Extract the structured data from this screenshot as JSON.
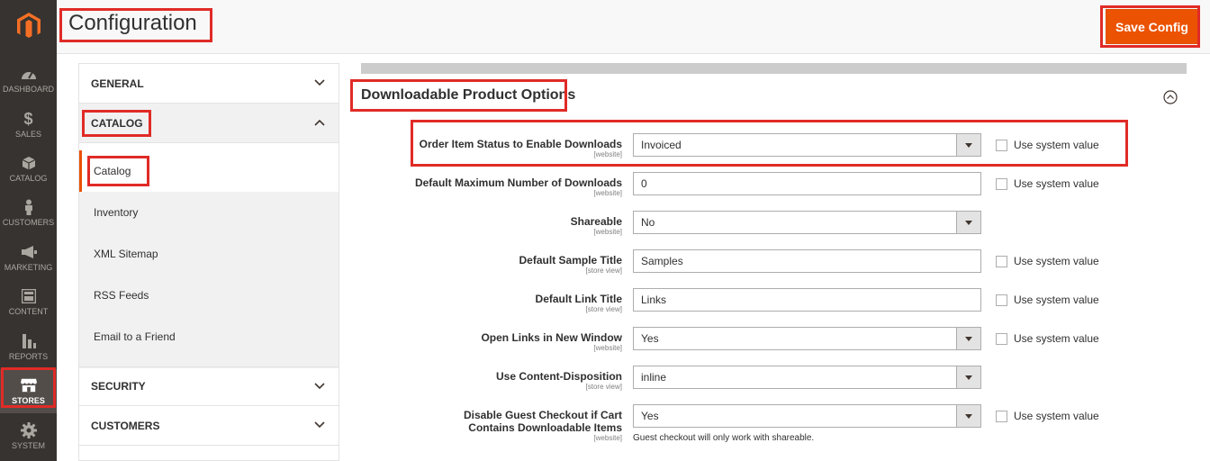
{
  "nav": {
    "items": [
      {
        "label": "DASHBOARD",
        "icon": "dashboard-icon"
      },
      {
        "label": "SALES",
        "icon": "dollar-icon"
      },
      {
        "label": "CATALOG",
        "icon": "box-icon"
      },
      {
        "label": "CUSTOMERS",
        "icon": "person-icon"
      },
      {
        "label": "MARKETING",
        "icon": "megaphone-icon"
      },
      {
        "label": "CONTENT",
        "icon": "layout-icon"
      },
      {
        "label": "REPORTS",
        "icon": "bar-chart-icon"
      },
      {
        "label": "STORES",
        "icon": "store-icon"
      },
      {
        "label": "SYSTEM",
        "icon": "gear-icon"
      }
    ]
  },
  "header": {
    "title": "Configuration",
    "save_label": "Save Config"
  },
  "tabs": {
    "general": "GENERAL",
    "catalog": "CATALOG",
    "security": "SECURITY",
    "customers": "CUSTOMERS",
    "catalog_items": [
      "Catalog",
      "Inventory",
      "XML Sitemap",
      "RSS Feeds",
      "Email to a Friend"
    ]
  },
  "section": {
    "title": "Downloadable Product Options",
    "fields": [
      {
        "label": "Order Item Status to Enable Downloads",
        "scope": "[website]",
        "value": "Invoiced",
        "type": "select",
        "system": true
      },
      {
        "label": "Default Maximum Number of Downloads",
        "scope": "[website]",
        "value": "0",
        "type": "text",
        "system": true
      },
      {
        "label": "Shareable",
        "scope": "[website]",
        "value": "No",
        "type": "select",
        "system": false
      },
      {
        "label": "Default Sample Title",
        "scope": "[store view]",
        "value": "Samples",
        "type": "text",
        "system": true
      },
      {
        "label": "Default Link Title",
        "scope": "[store view]",
        "value": "Links",
        "type": "text",
        "system": true
      },
      {
        "label": "Open Links in New Window",
        "scope": "[website]",
        "value": "Yes",
        "type": "select",
        "system": true
      },
      {
        "label": "Use Content-Disposition",
        "scope": "[store view]",
        "value": "inline",
        "type": "select",
        "system": false
      },
      {
        "label": "Disable Guest Checkout if Cart Contains Downloadable Items",
        "scope": "[website]",
        "value": "Yes",
        "type": "select",
        "system": true,
        "note": "Guest checkout will only work with shareable."
      }
    ],
    "system_value_label": "Use system value"
  },
  "colors": {
    "accent": "#eb5202",
    "highlight": "#e02b27",
    "nav_bg": "#373330"
  }
}
